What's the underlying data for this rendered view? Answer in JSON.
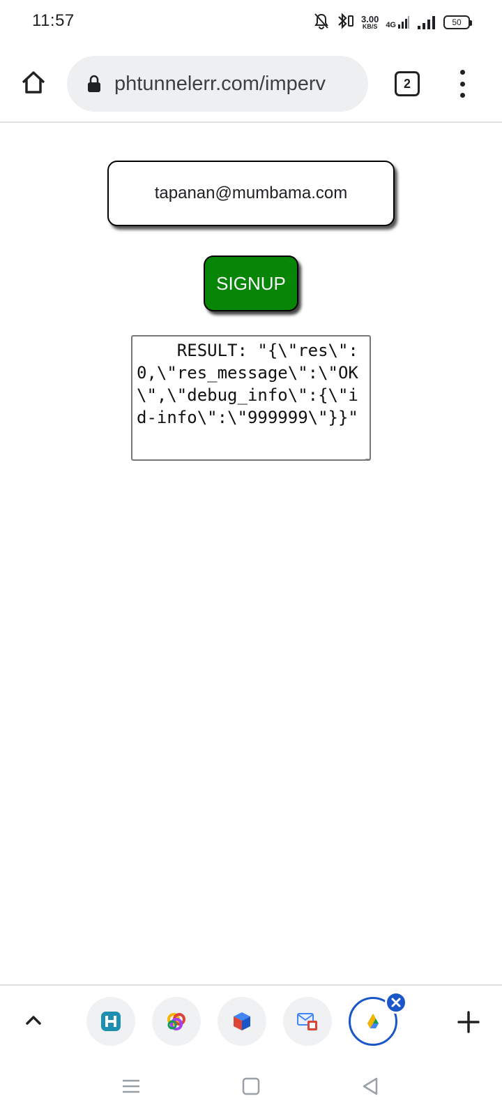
{
  "status_bar": {
    "time": "11:57",
    "speed_value": "3.00",
    "speed_unit": "KB/S",
    "network": "4G",
    "battery": "50"
  },
  "browser": {
    "url": "phtunnelerr.com/imperv",
    "tab_count": "2"
  },
  "page": {
    "email_value": "tapanan@mumbama.com",
    "signup_label": "SIGNUP",
    "result_text": "    RESULT: \"{\\\"res\\\":0,\\\"res_message\\\":\\\"OK\\\",\\\"debug_info\\\":{\\\"id-info\\\":\\\"999999\\\"}}\""
  },
  "bottom_tabs": {
    "items": [
      {
        "icon": "h-app-icon"
      },
      {
        "icon": "colorful-ring-app-icon"
      },
      {
        "icon": "box-app-icon"
      },
      {
        "icon": "mail-app-icon"
      },
      {
        "icon": "drive-triangle-app-icon",
        "active": true
      }
    ]
  },
  "colors": {
    "signup_bg": "#068506",
    "active_tab_ring": "#1a56c8"
  }
}
